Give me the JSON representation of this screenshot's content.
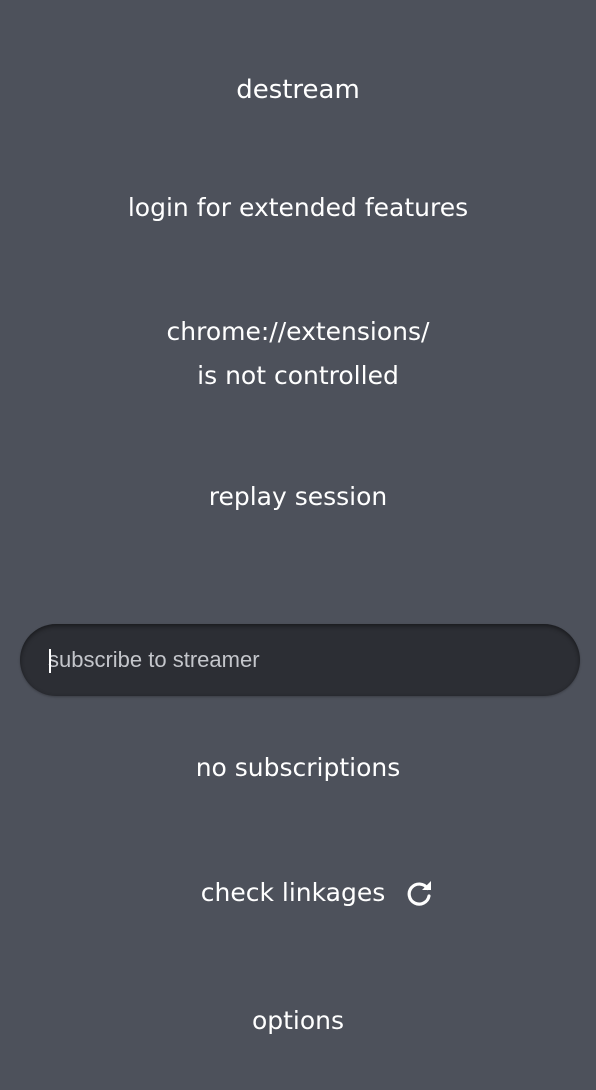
{
  "app": {
    "title": "destream"
  },
  "menu": {
    "login_label": "login for extended features",
    "status_line1": "chrome://extensions/",
    "status_line2": "is not controlled",
    "replay_label": "replay session",
    "subscriptions_label": "no subscriptions",
    "check_linkages_label": "check linkages",
    "options_label": "options"
  },
  "search": {
    "placeholder": "subscribe to streamer",
    "value": ""
  },
  "icons": {
    "refresh": "refresh-icon"
  },
  "colors": {
    "background": "#4d515b",
    "input_background": "#2c2e34",
    "text": "#ffffff"
  }
}
